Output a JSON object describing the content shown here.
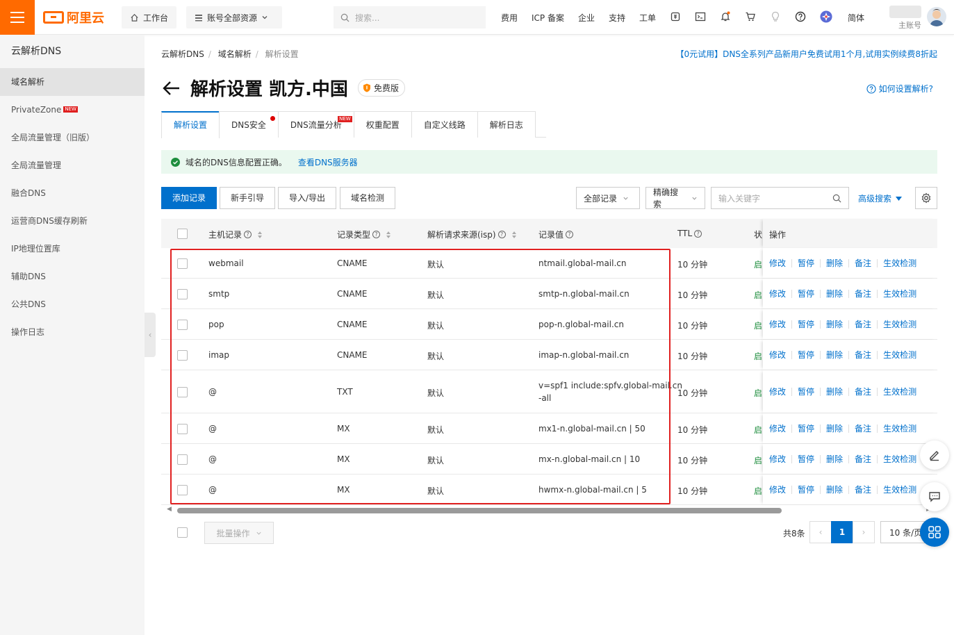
{
  "topbar": {
    "logo_text": "阿里云",
    "workbench": "工作台",
    "resources": "账号全部资源",
    "search_placeholder": "搜索...",
    "nav": [
      "费用",
      "ICP 备案",
      "企业",
      "支持",
      "工单"
    ],
    "lang": "简体",
    "account_label": "主账号",
    "icons": [
      "menu-icon",
      "home-icon",
      "resource-icon",
      "search-icon",
      "bill-icon",
      "terminal-icon",
      "bell-icon",
      "cart-icon",
      "bulb-icon",
      "help-icon",
      "app-icon",
      "avatar"
    ]
  },
  "sidebar": {
    "title": "云解析DNS",
    "items": [
      {
        "label": "域名解析",
        "active": true
      },
      {
        "label": "PrivateZone",
        "new": "NEW"
      },
      {
        "label": "全局流量管理（旧版）"
      },
      {
        "label": "全局流量管理"
      },
      {
        "label": "融合DNS"
      },
      {
        "label": "运营商DNS缓存刷新"
      },
      {
        "label": "IP地理位置库"
      },
      {
        "label": "辅助DNS"
      },
      {
        "label": "公共DNS"
      },
      {
        "label": "操作日志"
      }
    ]
  },
  "breadcrumb": [
    "云解析DNS",
    "域名解析",
    "解析设置"
  ],
  "promo": "【0元试用】DNS全系列产品新用户免费试用1个月,试用实例续费8折起",
  "header": {
    "title": "解析设置 凯方.中国",
    "badge": "免费版",
    "help": "如何设置解析?"
  },
  "tabs": [
    {
      "label": "解析设置",
      "active": true
    },
    {
      "label": "DNS安全",
      "dot": true
    },
    {
      "label": "DNS流量分析",
      "new": "NEW"
    },
    {
      "label": "权重配置"
    },
    {
      "label": "自定义线路"
    },
    {
      "label": "解析日志"
    }
  ],
  "alert": {
    "text": "域名的DNS信息配置正确。",
    "link": "查看DNS服务器"
  },
  "toolbar": {
    "add": "添加记录",
    "guide": "新手引导",
    "import": "导入/导出",
    "check": "域名检测",
    "filter_all": "全部记录",
    "exact_search": "精确搜索",
    "keyword_placeholder": "输入关键字",
    "advanced": "高级搜索"
  },
  "table": {
    "columns": [
      "主机记录",
      "记录类型",
      "解析请求来源(isp)",
      "记录值",
      "TTL",
      "状",
      "操作"
    ],
    "rows": [
      {
        "host": "webmail",
        "type": "CNAME",
        "isp": "默认",
        "value": "ntmail.global-mail.cn",
        "ttl": "10 分钟",
        "status": "启"
      },
      {
        "host": "smtp",
        "type": "CNAME",
        "isp": "默认",
        "value": "smtp-n.global-mail.cn",
        "ttl": "10 分钟",
        "status": "启"
      },
      {
        "host": "pop",
        "type": "CNAME",
        "isp": "默认",
        "value": "pop-n.global-mail.cn",
        "ttl": "10 分钟",
        "status": "启"
      },
      {
        "host": "imap",
        "type": "CNAME",
        "isp": "默认",
        "value": "imap-n.global-mail.cn",
        "ttl": "10 分钟",
        "status": "启"
      },
      {
        "host": "@",
        "type": "TXT",
        "isp": "默认",
        "value": "v=spf1 include:spfv.global-mail.cn",
        "value2": "-all",
        "ttl": "10 分钟",
        "status": "启"
      },
      {
        "host": "@",
        "type": "MX",
        "isp": "默认",
        "value": "mx1-n.global-mail.cn | 50",
        "ttl": "10 分钟",
        "status": "启"
      },
      {
        "host": "@",
        "type": "MX",
        "isp": "默认",
        "value": "mx-n.global-mail.cn | 10",
        "ttl": "10 分钟",
        "status": "启"
      },
      {
        "host": "@",
        "type": "MX",
        "isp": "默认",
        "value": "hwmx-n.global-mail.cn | 5",
        "ttl": "10 分钟",
        "status": "启"
      }
    ],
    "ops": [
      "修改",
      "暂停",
      "删除",
      "备注",
      "生效检测"
    ]
  },
  "footer": {
    "batch": "批量操作",
    "total": "共8条",
    "page": "1",
    "page_size": "10 条/页"
  },
  "colors": {
    "brand": "#ff6a00",
    "link": "#0070cc",
    "highlight": "#e02020"
  }
}
